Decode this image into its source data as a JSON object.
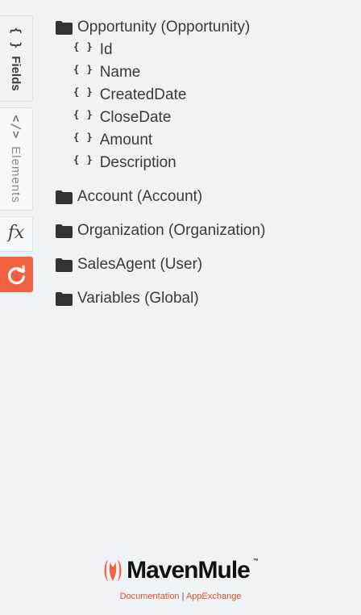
{
  "sidebar": {
    "tabs": [
      {
        "label": "Fields",
        "icon": "curly-braces-icon"
      },
      {
        "label": "Elements",
        "icon": "code-brackets-icon"
      },
      {
        "label": "fx",
        "icon": "formula-icon"
      },
      {
        "label": "",
        "icon": "refresh-icon"
      }
    ],
    "accent": "#f2613f"
  },
  "tree": {
    "groups": [
      {
        "label": "Opportunity (Opportunity)",
        "expanded": true,
        "fields": [
          "Id",
          "Name",
          "CreatedDate",
          "CloseDate",
          "Amount",
          "Description"
        ]
      },
      {
        "label": "Account (Account)",
        "expanded": false
      },
      {
        "label": "Organization (Organization)",
        "expanded": false
      },
      {
        "label": "SalesAgent (User)",
        "expanded": false
      },
      {
        "label": "Variables (Global)",
        "expanded": false
      }
    ],
    "field_icon_text": "{ }"
  },
  "footer": {
    "brand": "MavenMule",
    "trademark": "™",
    "documentation_link": "Documentation",
    "separator": "|",
    "appexchange_link": "AppExchange",
    "link_color": "#d9532b"
  }
}
